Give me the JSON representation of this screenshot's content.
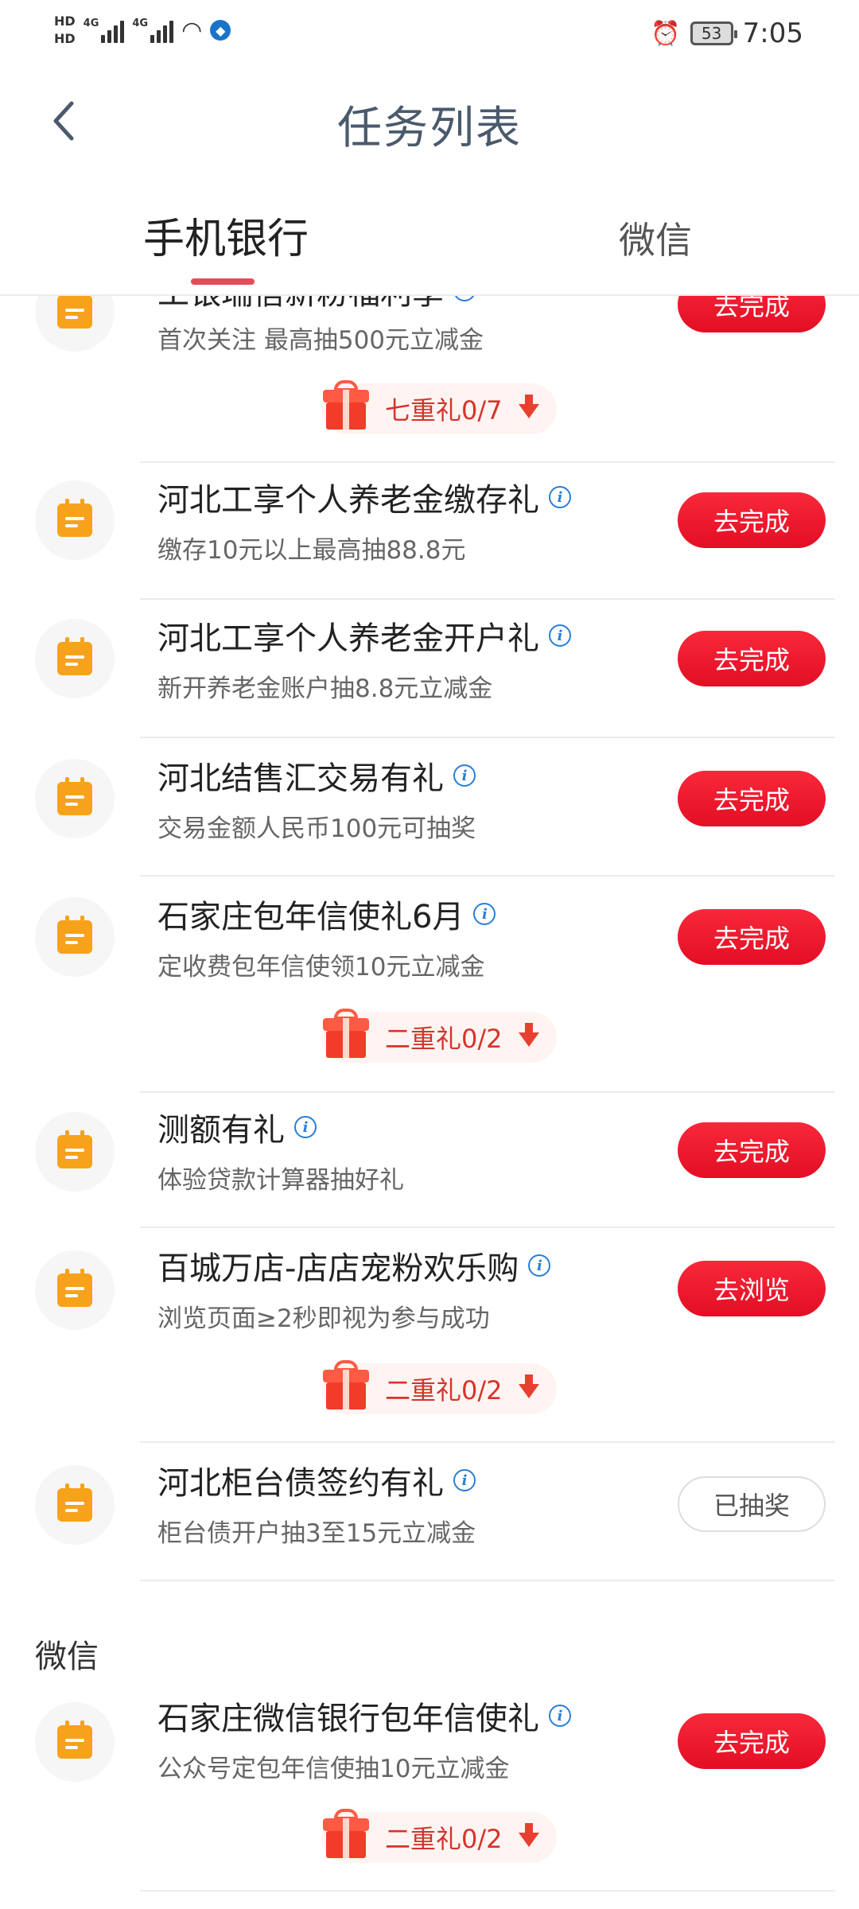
{
  "status_bar": {
    "hd1": "HD",
    "hd2": "HD",
    "sig1": "4G",
    "sig2": "4G",
    "battery": "53",
    "time": "7:05"
  },
  "nav": {
    "back_icon": "chevron-left-icon",
    "title": "任务列表"
  },
  "tabs": {
    "active": "手机银行",
    "inactive": "微信"
  },
  "tasks": [
    {
      "title": "工银瑞信新粉福利季",
      "subtitle": "首次关注 最高抽500元立减金",
      "button": "去完成",
      "gift": "七重礼0/7"
    },
    {
      "title": "河北工享个人养老金缴存礼",
      "subtitle": "缴存10元以上最高抽88.8元",
      "button": "去完成"
    },
    {
      "title": "河北工享个人养老金开户礼",
      "subtitle": "新开养老金账户抽8.8元立减金",
      "button": "去完成"
    },
    {
      "title": "河北结售汇交易有礼",
      "subtitle": "交易金额人民币100元可抽奖",
      "button": "去完成"
    },
    {
      "title": "石家庄包年信使礼6月",
      "subtitle": "定收费包年信使领10元立减金",
      "button": "去完成",
      "gift": "二重礼0/2"
    },
    {
      "title": "测额有礼",
      "subtitle": "体验贷款计算器抽好礼",
      "button": "去完成"
    },
    {
      "title": "百城万店-店店宠粉欢乐购",
      "subtitle": "浏览页面≥2秒即视为参与成功",
      "button": "去浏览",
      "gift": "二重礼0/2"
    },
    {
      "title": "河北柜台债签约有礼",
      "subtitle": "柜台债开户抽3至15元立减金",
      "button": "已抽奖"
    }
  ],
  "section_wechat": {
    "heading": "微信",
    "tasks": [
      {
        "title": "石家庄微信银行包年信使礼",
        "subtitle": "公众号定包年信使抽10元立减金",
        "button": "去完成",
        "gift": "二重礼0/2"
      }
    ]
  },
  "colors": {
    "accent_red": "#e30e24",
    "tab_underline": "#e84a5a",
    "icon_orange": "#f7a21b",
    "info_blue": "#2a7fd6"
  }
}
